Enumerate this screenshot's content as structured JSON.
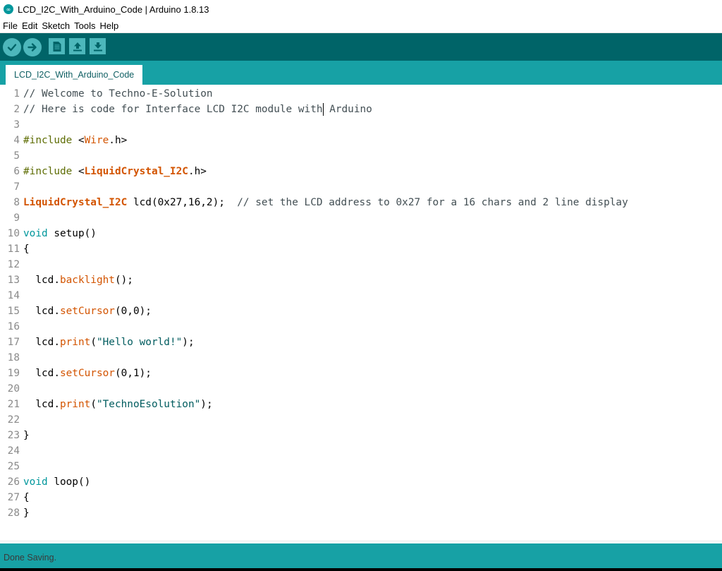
{
  "window": {
    "title": "LCD_I2C_With_Arduino_Code | Arduino 1.8.13",
    "icon": "arduino-logo-icon"
  },
  "menu": [
    "File",
    "Edit",
    "Sketch",
    "Tools",
    "Help"
  ],
  "toolbar": {
    "buttons": [
      "verify-icon",
      "upload-icon",
      "new-icon",
      "open-icon",
      "save-icon"
    ]
  },
  "tabs": [
    {
      "label": "LCD_I2C_With_Arduino_Code"
    }
  ],
  "editor": {
    "lines": [
      [
        {
          "t": "// Welcome to Techno-E-Solution",
          "c": "comment"
        }
      ],
      [
        {
          "t": "// Here is code for Interface LCD I2C module with",
          "c": "comment"
        },
        {
          "t": "|",
          "c": "caret"
        },
        {
          "t": " Arduino",
          "c": "comment"
        }
      ],
      [],
      [
        {
          "t": "#include",
          "c": "pre"
        },
        {
          "t": " <",
          "c": "plain"
        },
        {
          "t": "Wire",
          "c": "lib"
        },
        {
          "t": ".h>",
          "c": "plain"
        }
      ],
      [],
      [
        {
          "t": "#include",
          "c": "pre"
        },
        {
          "t": " <",
          "c": "plain"
        },
        {
          "t": "LiquidCrystal_I2C",
          "c": "libbold"
        },
        {
          "t": ".h>",
          "c": "plain"
        }
      ],
      [],
      [
        {
          "t": "LiquidCrystal_I2C",
          "c": "libbold"
        },
        {
          "t": " lcd(0x27,16,2);  ",
          "c": "plain"
        },
        {
          "t": "// set the LCD address to 0x27 for a 16 chars and 2 line display",
          "c": "comment"
        }
      ],
      [],
      [
        {
          "t": "void",
          "c": "kw"
        },
        {
          "t": " setup()",
          "c": "plain"
        }
      ],
      [
        {
          "t": "{",
          "c": "plain"
        }
      ],
      [],
      [
        {
          "t": "  lcd.",
          "c": "plain"
        },
        {
          "t": "backlight",
          "c": "fn"
        },
        {
          "t": "();",
          "c": "plain"
        }
      ],
      [],
      [
        {
          "t": "  lcd.",
          "c": "plain"
        },
        {
          "t": "setCursor",
          "c": "fn"
        },
        {
          "t": "(0,0);",
          "c": "plain"
        }
      ],
      [],
      [
        {
          "t": "  lcd.",
          "c": "plain"
        },
        {
          "t": "print",
          "c": "fn"
        },
        {
          "t": "(",
          "c": "plain"
        },
        {
          "t": "\"Hello world!\"",
          "c": "str"
        },
        {
          "t": ");",
          "c": "plain"
        }
      ],
      [],
      [
        {
          "t": "  lcd.",
          "c": "plain"
        },
        {
          "t": "setCursor",
          "c": "fn"
        },
        {
          "t": "(0,1);",
          "c": "plain"
        }
      ],
      [],
      [
        {
          "t": "  lcd.",
          "c": "plain"
        },
        {
          "t": "print",
          "c": "fn"
        },
        {
          "t": "(",
          "c": "plain"
        },
        {
          "t": "\"TechnoEsolution\"",
          "c": "str"
        },
        {
          "t": ");",
          "c": "plain"
        }
      ],
      [],
      [
        {
          "t": "}",
          "c": "plain"
        }
      ],
      [],
      [],
      [
        {
          "t": "void",
          "c": "kw"
        },
        {
          "t": " loop()",
          "c": "plain"
        }
      ],
      [
        {
          "t": "{",
          "c": "plain"
        }
      ],
      [
        {
          "t": "}",
          "c": "plain"
        }
      ]
    ]
  },
  "status": {
    "message": "Done Saving."
  },
  "colors": {
    "toolbar": "#006468",
    "tabstrip": "#17a1a5",
    "button": "#4db7bb",
    "keyword": "#00979c",
    "library": "#d35400",
    "preprocessor": "#5e6d03",
    "string": "#005c5f",
    "comment": "#434f54"
  }
}
